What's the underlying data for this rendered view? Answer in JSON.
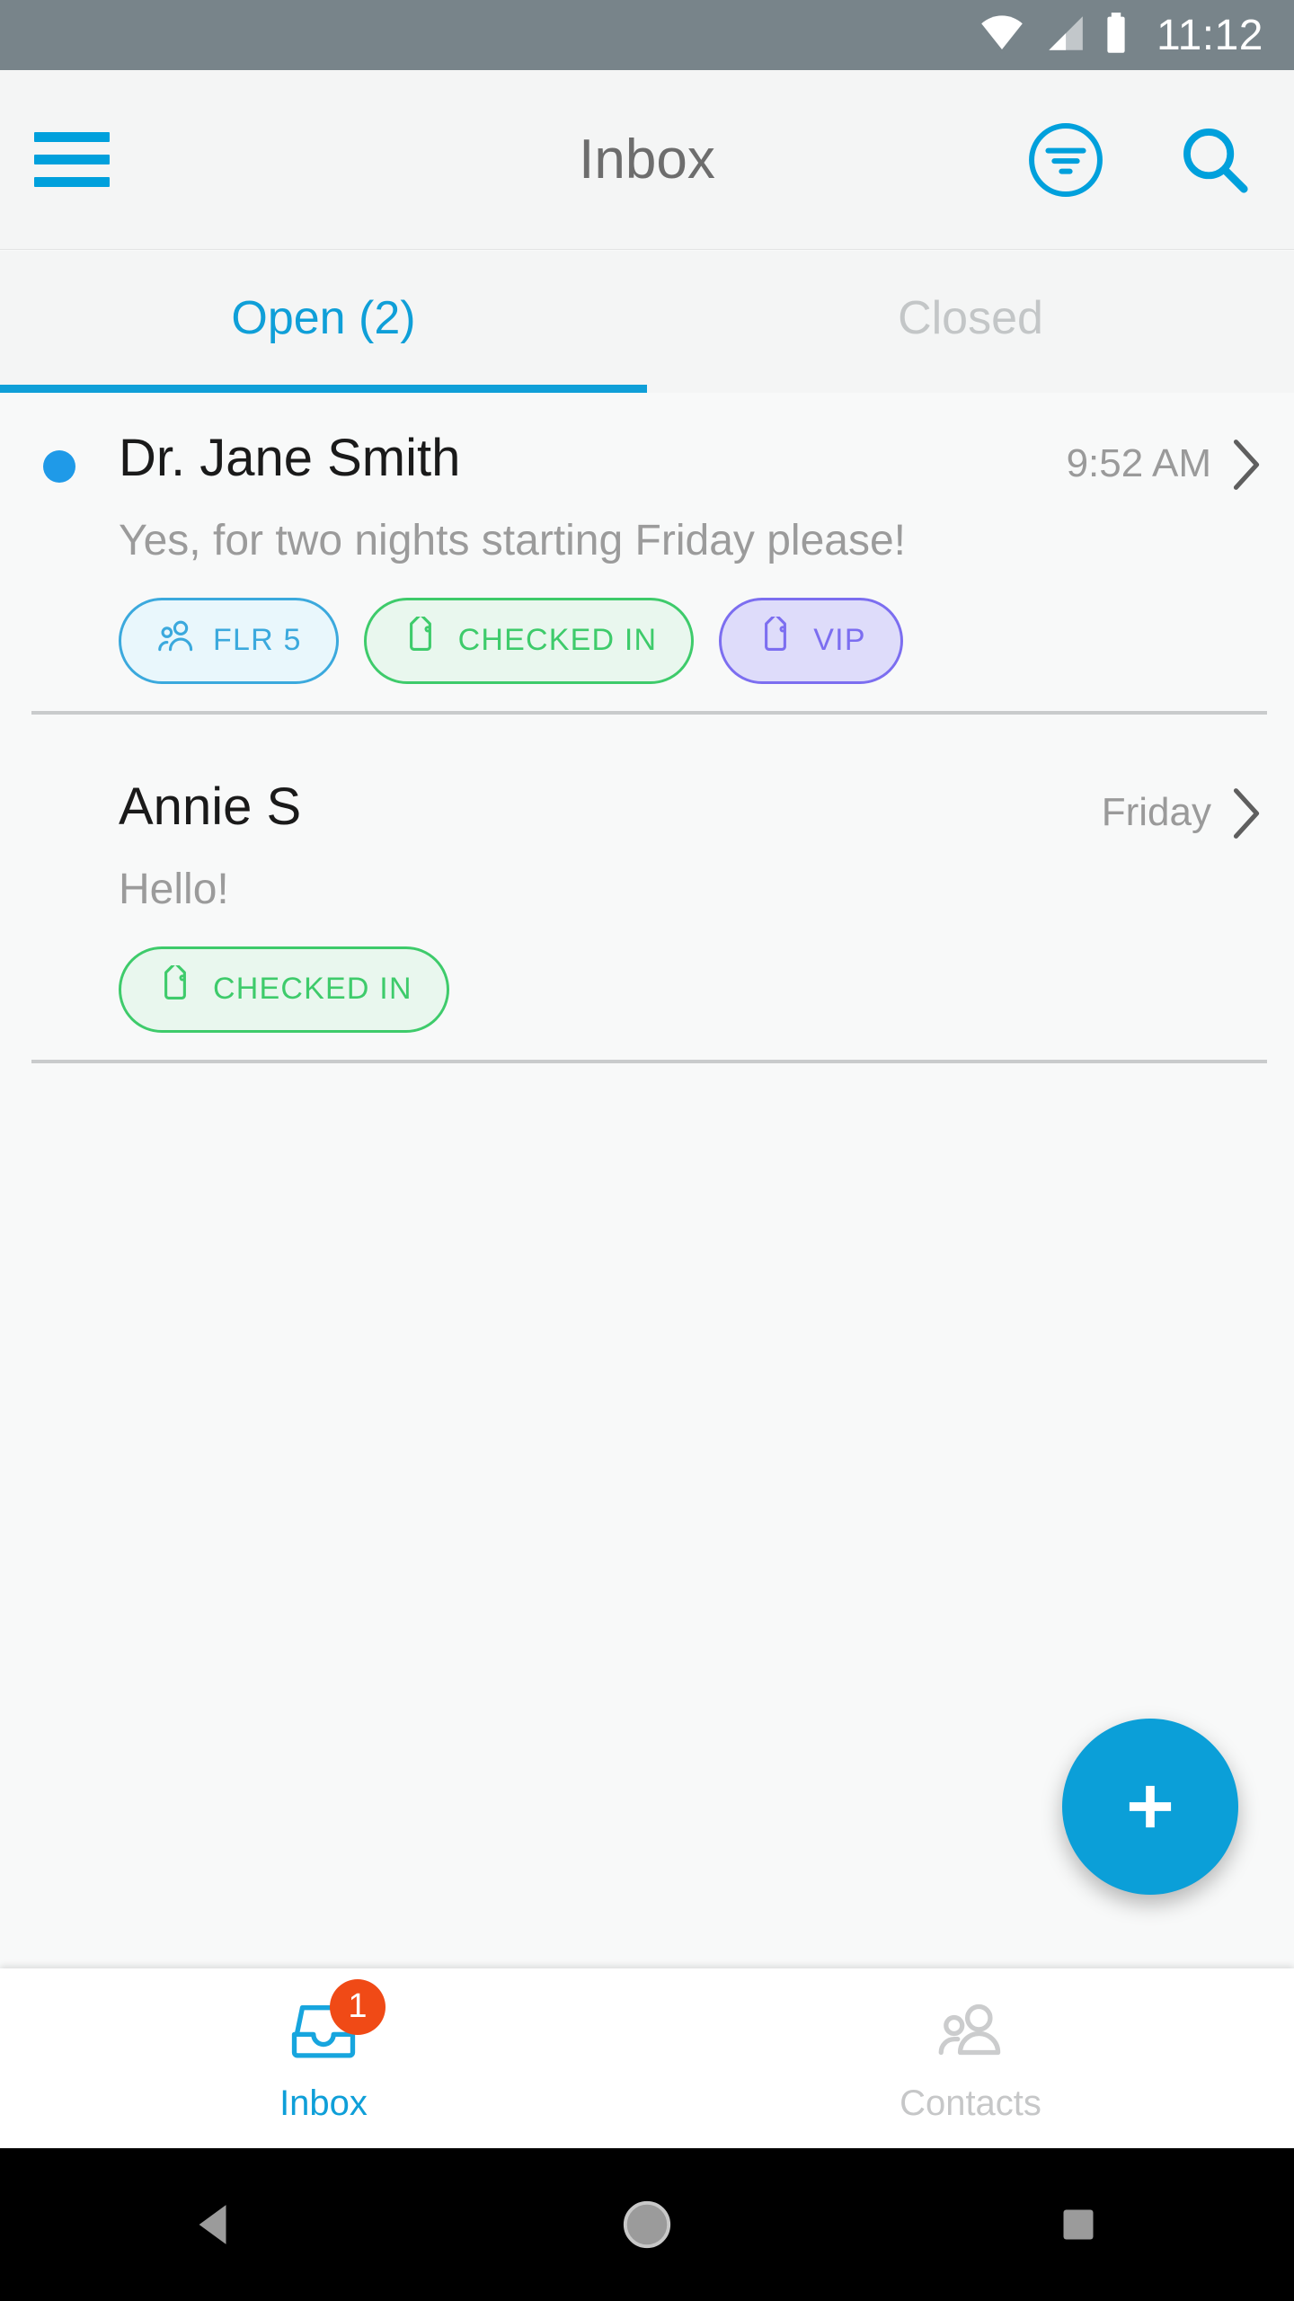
{
  "status_bar": {
    "time": "11:12",
    "icons": [
      "wifi-icon",
      "cellular-signal-icon",
      "battery-icon"
    ],
    "background": "#78848a"
  },
  "toolbar": {
    "title": "Inbox",
    "menu_icon": "hamburger-menu-icon",
    "filter_icon": "filter-icon",
    "search_icon": "search-icon",
    "accent": "#00a0dc"
  },
  "tabs": {
    "items": [
      {
        "label": "Open (2)",
        "active": true
      },
      {
        "label": "Closed",
        "active": false
      }
    ],
    "active_color": "#0f9fd8",
    "inactive_color": "#c3c6c7"
  },
  "conversations": [
    {
      "name": "Dr. Jane Smith",
      "time": "9:52 AM",
      "preview": "Yes, for two nights starting Friday please!",
      "unread": true,
      "tags": [
        {
          "label": "FLR 5",
          "icon": "people-icon",
          "color": "#3ba9dd",
          "bg": "#e9f7fc"
        },
        {
          "label": "CHECKED IN",
          "icon": "tag-icon",
          "color": "#3ecb6b",
          "bg": "#e9f7ee"
        },
        {
          "label": "VIP",
          "icon": "tag-icon",
          "color": "#7c6ef0",
          "bg": "#dedcfa"
        }
      ]
    },
    {
      "name": "Annie S",
      "time": "Friday",
      "preview": "Hello!",
      "unread": false,
      "tags": [
        {
          "label": "CHECKED IN",
          "icon": "tag-icon",
          "color": "#3ecb6b",
          "bg": "#e9f7ee"
        }
      ]
    }
  ],
  "fab": {
    "label": "+",
    "icon": "plus-icon",
    "color": "#0b9fd8"
  },
  "bottom_nav": {
    "items": [
      {
        "label": "Inbox",
        "icon": "inbox-tray-icon",
        "active": true,
        "badge": "1"
      },
      {
        "label": "Contacts",
        "icon": "contacts-people-icon",
        "active": false,
        "badge": null
      }
    ],
    "badge_color": "#f04a16"
  },
  "system_nav": {
    "back": "back-triangle-icon",
    "home": "home-circle-icon",
    "recents": "recents-square-icon"
  }
}
